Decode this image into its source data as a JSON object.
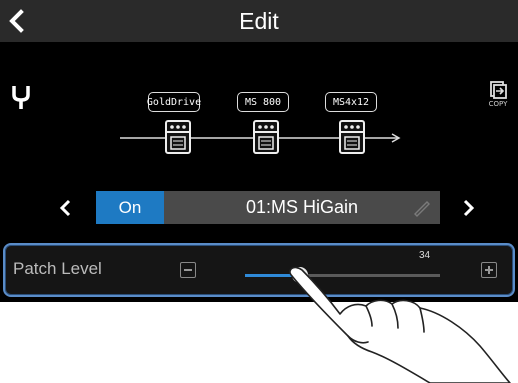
{
  "header": {
    "title": "Edit",
    "back_icon": "chevron-left-icon"
  },
  "toolbar": {
    "tuner_icon": "tuner-fork-icon",
    "copy_label": "COPY",
    "copy_icon": "copy-icon"
  },
  "effect_chain": [
    {
      "name": "GoldDrive"
    },
    {
      "name": "MS 800"
    },
    {
      "name": "MS4x12"
    }
  ],
  "patch": {
    "on_label": "On",
    "name": "01:MS HiGain",
    "edit_icon": "pencil-icon"
  },
  "patch_level": {
    "label": "Patch Level",
    "value": "34",
    "level": 34,
    "max": 120
  },
  "colors": {
    "accent": "#1e7ac3",
    "highlight_border": "#5a8cc8"
  }
}
